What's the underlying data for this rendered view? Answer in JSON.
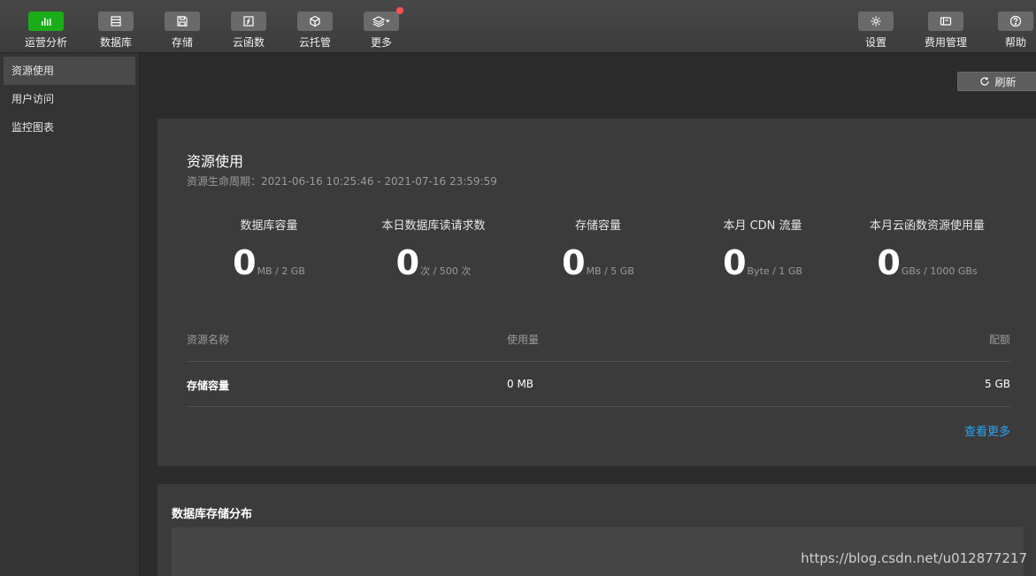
{
  "toolbar": {
    "left_tools": [
      {
        "label": "运营分析",
        "icon": "bar-chart-icon",
        "active": true
      },
      {
        "label": "数据库",
        "icon": "database-icon"
      },
      {
        "label": "存储",
        "icon": "save-icon"
      },
      {
        "label": "云函数",
        "icon": "function-icon"
      },
      {
        "label": "云托管",
        "icon": "cube-icon"
      },
      {
        "label": "更多",
        "icon": "layers-icon",
        "badge": true
      }
    ],
    "right_tools": [
      {
        "label": "设置",
        "icon": "gear-icon"
      },
      {
        "label": "费用管理",
        "icon": "wallet-icon"
      },
      {
        "label": "帮助",
        "icon": "help-icon"
      }
    ]
  },
  "sidebar": {
    "items": [
      {
        "label": "资源使用",
        "active": true
      },
      {
        "label": "用户访问"
      },
      {
        "label": "监控图表"
      }
    ]
  },
  "refresh_label": "刷新",
  "resource_card": {
    "title": "资源使用",
    "lifecycle": "资源生命周期：2021-06-16 10:25:46 - 2021-07-16 23:59:59",
    "metrics": [
      {
        "name": "数据库容量",
        "value": "0",
        "unit": "MB / 2 GB"
      },
      {
        "name": "本日数据库读请求数",
        "value": "0",
        "unit": "次 / 500 次"
      },
      {
        "name": "存储容量",
        "value": "0",
        "unit": "MB / 5 GB"
      },
      {
        "name": "本月 CDN 流量",
        "value": "0",
        "unit": "Byte / 1 GB"
      },
      {
        "name": "本月云函数资源使用量",
        "value": "0",
        "unit": "GBs / 1000 GBs"
      }
    ],
    "table": {
      "headers": [
        "资源名称",
        "使用量",
        "配额"
      ],
      "rows": [
        [
          "存储容量",
          "0 MB",
          "5 GB"
        ]
      ]
    },
    "more_link": "查看更多"
  },
  "db_card": {
    "title": "数据库存储分布"
  },
  "watermark": "https://blog.csdn.net/u012877217",
  "colors": {
    "accent": "#1aad19",
    "link": "#2ba3f2",
    "badge": "#fa5151"
  }
}
